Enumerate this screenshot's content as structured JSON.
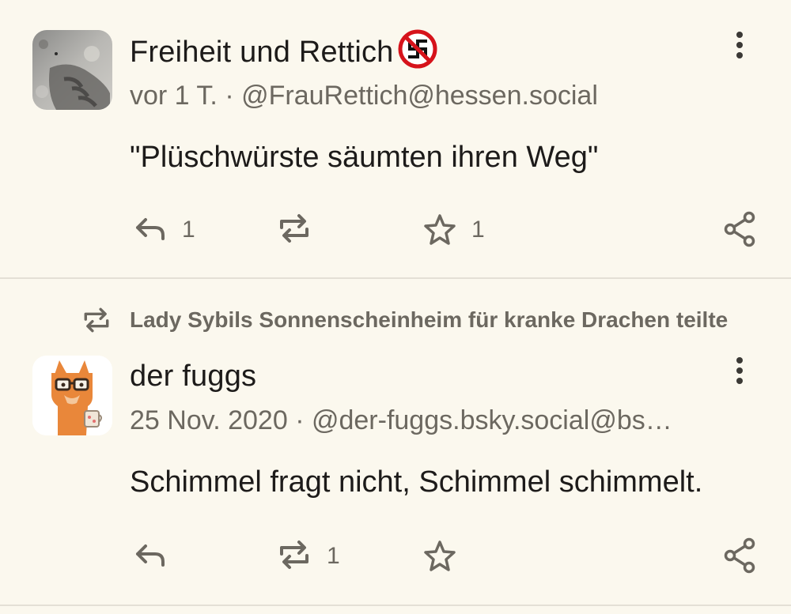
{
  "posts": [
    {
      "display_name": "Freiheit und Rettich",
      "name_badge_icon": "no-swastika-icon",
      "time": "vor 1 T.",
      "separator": "·",
      "handle": "@FrauRettich@hessen.social",
      "content": "\"Plüschwürste säumten ihren Weg\"",
      "replies": "1",
      "boosts": "",
      "favourites": "1"
    },
    {
      "boosted_by": "Lady Sybils Sonnenscheinheim für kranke Drachen teilte",
      "display_name": "der fuggs",
      "time": "25 Nov. 2020",
      "separator": "·",
      "handle": "@der-fuggs.bsky.social@bs…",
      "content": "Schimmel fragt nicht, Schimmel schimmelt.",
      "replies": "",
      "boosts": "1",
      "favourites": ""
    }
  ],
  "colors": {
    "background": "#fbf8ee",
    "text": "#1d1b1a",
    "secondary_text": "#6c6860",
    "divider": "#e4e0d6",
    "avatar_fox": "#e9873a"
  }
}
